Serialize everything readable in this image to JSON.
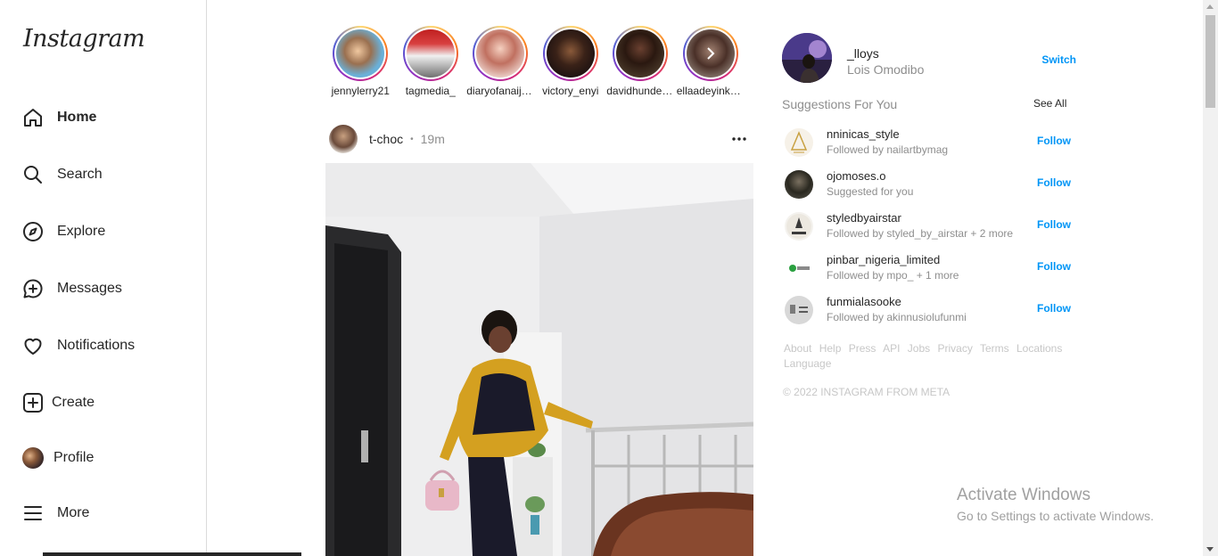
{
  "sidebar": {
    "logo": "Instagram",
    "items": [
      {
        "label": "Home",
        "icon": "home-icon"
      },
      {
        "label": "Search",
        "icon": "search-icon"
      },
      {
        "label": "Explore",
        "icon": "compass-icon"
      },
      {
        "label": "Messages",
        "icon": "messenger-icon"
      },
      {
        "label": "Notifications",
        "icon": "heart-icon"
      },
      {
        "label": "Create",
        "icon": "plus-square-icon"
      },
      {
        "label": "Profile",
        "icon": "avatar"
      },
      {
        "label": "More",
        "icon": "menu-icon"
      }
    ]
  },
  "stories": [
    {
      "name": "jennylerry21"
    },
    {
      "name": "tagmedia_"
    },
    {
      "name": "diaryofanaija..."
    },
    {
      "name": "victory_enyi"
    },
    {
      "name": "davidhundeyin"
    },
    {
      "name": "ellaadeyinka..."
    }
  ],
  "post": {
    "username": "t-choc",
    "dot": "•",
    "time": "19m"
  },
  "profile": {
    "username": "_lloys",
    "fullname": "Lois Omodibo",
    "switch_label": "Switch"
  },
  "suggestions": {
    "title": "Suggestions For You",
    "see_all": "See All",
    "follow_label": "Follow",
    "items": [
      {
        "username": "nninicas_style",
        "detail": "Followed by nailartbymag"
      },
      {
        "username": "ojomoses.o",
        "detail": "Suggested for you"
      },
      {
        "username": "styledbyairstar",
        "detail": "Followed by styled_by_airstar + 2 more"
      },
      {
        "username": "pinbar_nigeria_limited",
        "detail": "Followed by mpo_ + 1 more"
      },
      {
        "username": "funmialasooke",
        "detail": "Followed by akinnusiolufunmi"
      }
    ]
  },
  "footer": {
    "links": [
      "About",
      "Help",
      "Press",
      "API",
      "Jobs",
      "Privacy",
      "Terms",
      "Locations",
      "Language"
    ],
    "copyright": "© 2022 INSTAGRAM FROM META"
  },
  "watermark": {
    "line1": "Activate Windows",
    "line2": "Go to Settings to activate Windows."
  },
  "colors": {
    "accent": "#0095f6",
    "text": "#262626",
    "muted": "#8e8e8e",
    "border": "#dbdbdb"
  }
}
